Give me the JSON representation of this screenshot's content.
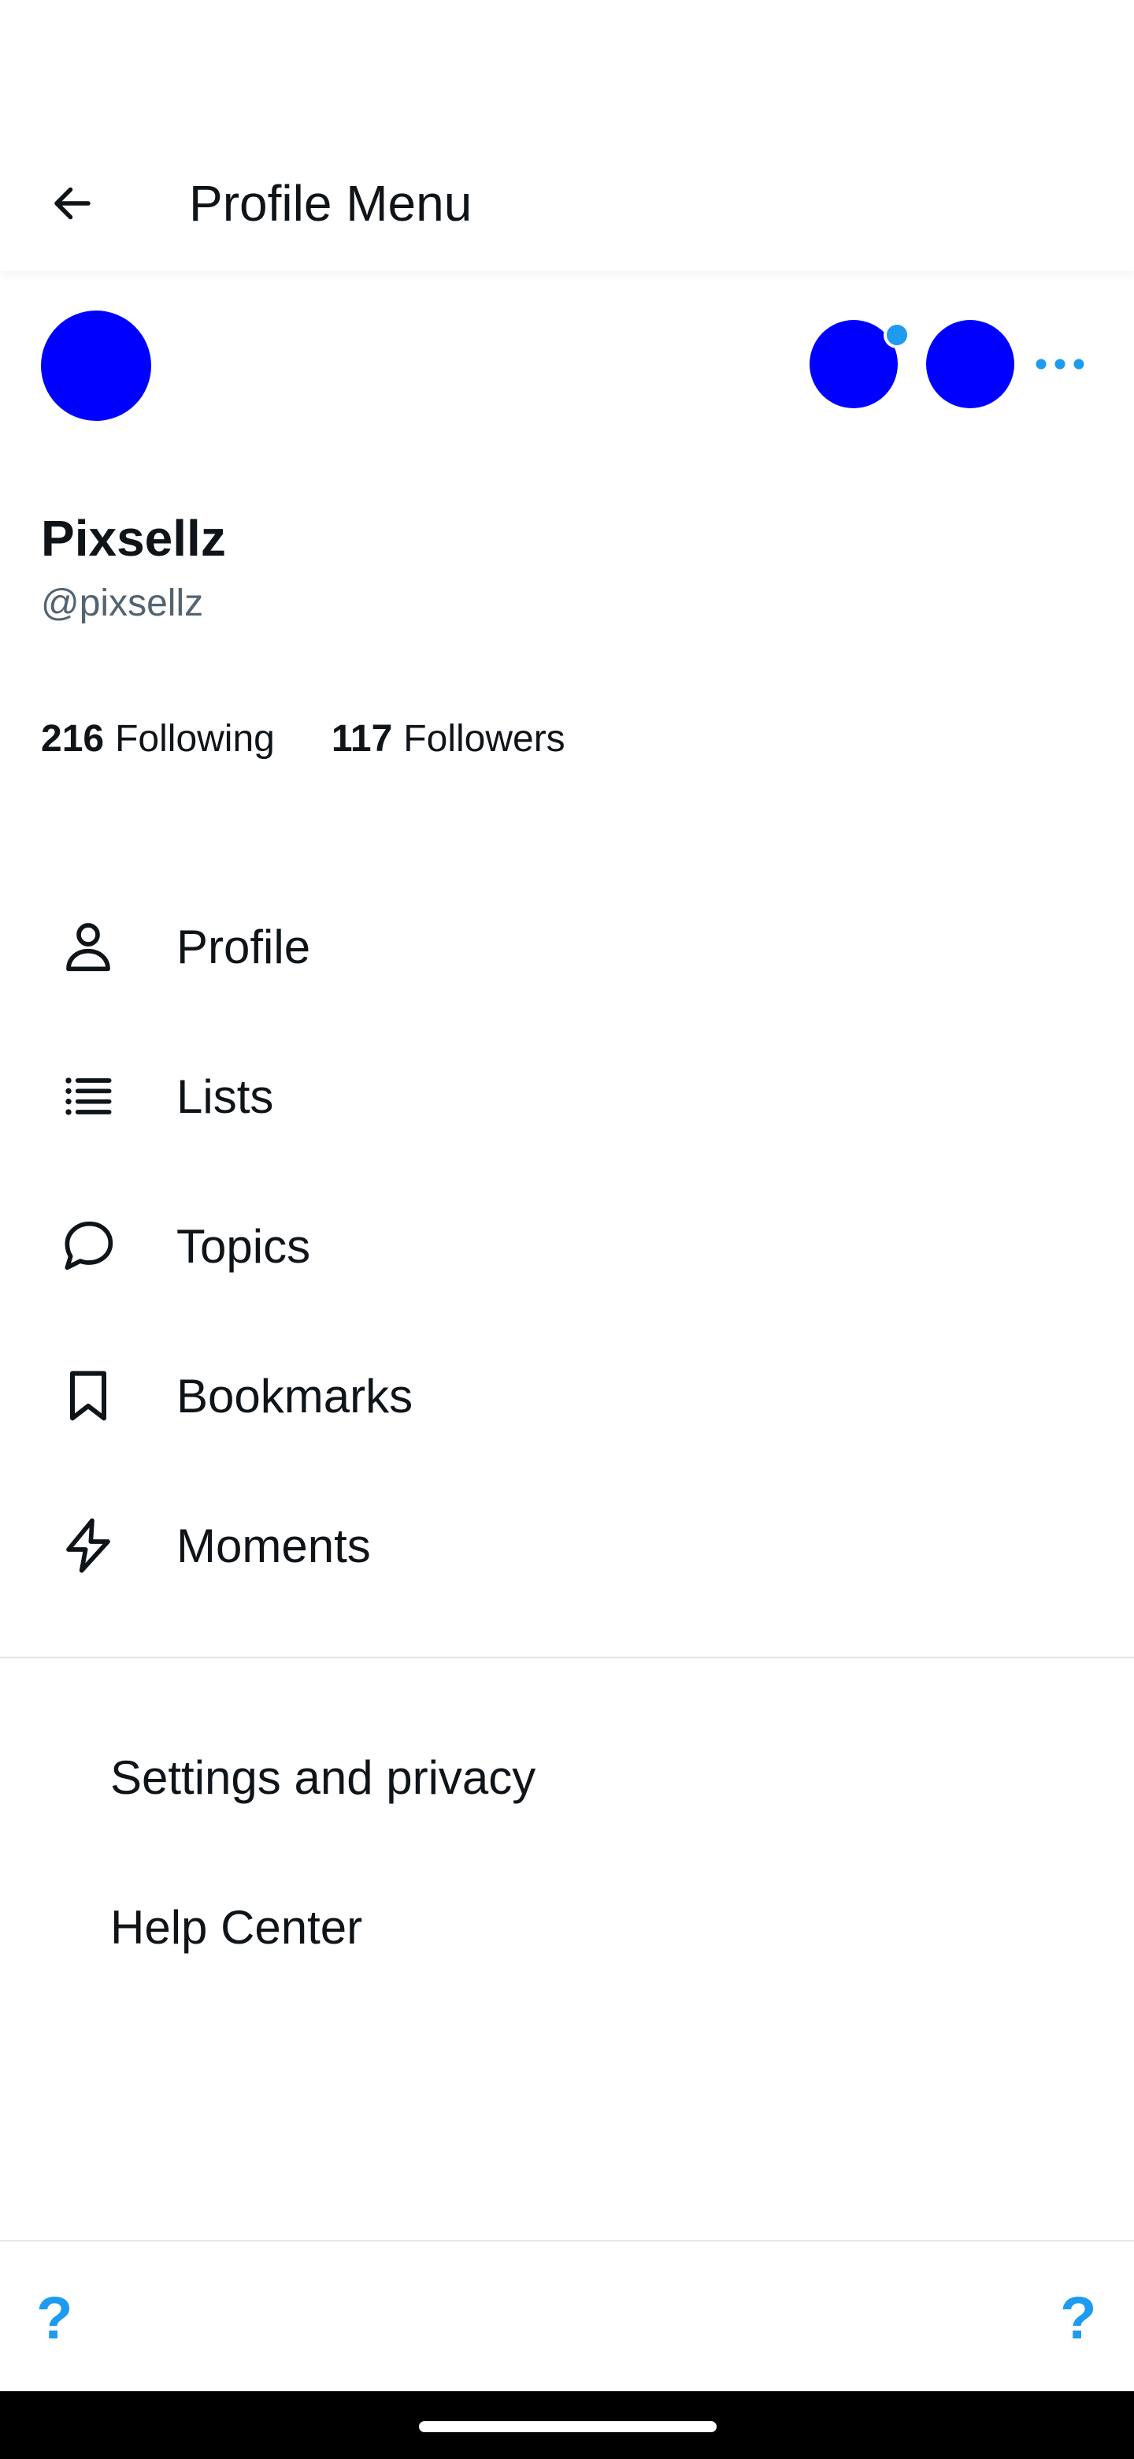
{
  "app_bar": {
    "title": "Profile Menu",
    "back_icon": "arrow-left-icon"
  },
  "account": {
    "display_name": "Pixsellz",
    "username": "@pixsellz",
    "avatar_color": "#0000ff",
    "notification_dot_color": "#1d9bf0",
    "more_icon": "more-horizontal-icon"
  },
  "stats": {
    "following_count": "216",
    "following_label": "Following",
    "followers_count": "117",
    "followers_label": "Followers"
  },
  "menu": {
    "items": [
      {
        "label": "Profile",
        "icon": "person-icon"
      },
      {
        "label": "Lists",
        "icon": "list-icon"
      },
      {
        "label": "Topics",
        "icon": "speech-bubble-icon"
      },
      {
        "label": "Bookmarks",
        "icon": "bookmark-icon"
      },
      {
        "label": "Moments",
        "icon": "lightning-icon"
      }
    ]
  },
  "secondary_menu": {
    "items": [
      {
        "label": "Settings and privacy"
      },
      {
        "label": "Help Center"
      }
    ]
  },
  "bottom_bar": {
    "left_glyph": "?",
    "right_glyph": "?",
    "accent_color": "#1d9bf0"
  }
}
